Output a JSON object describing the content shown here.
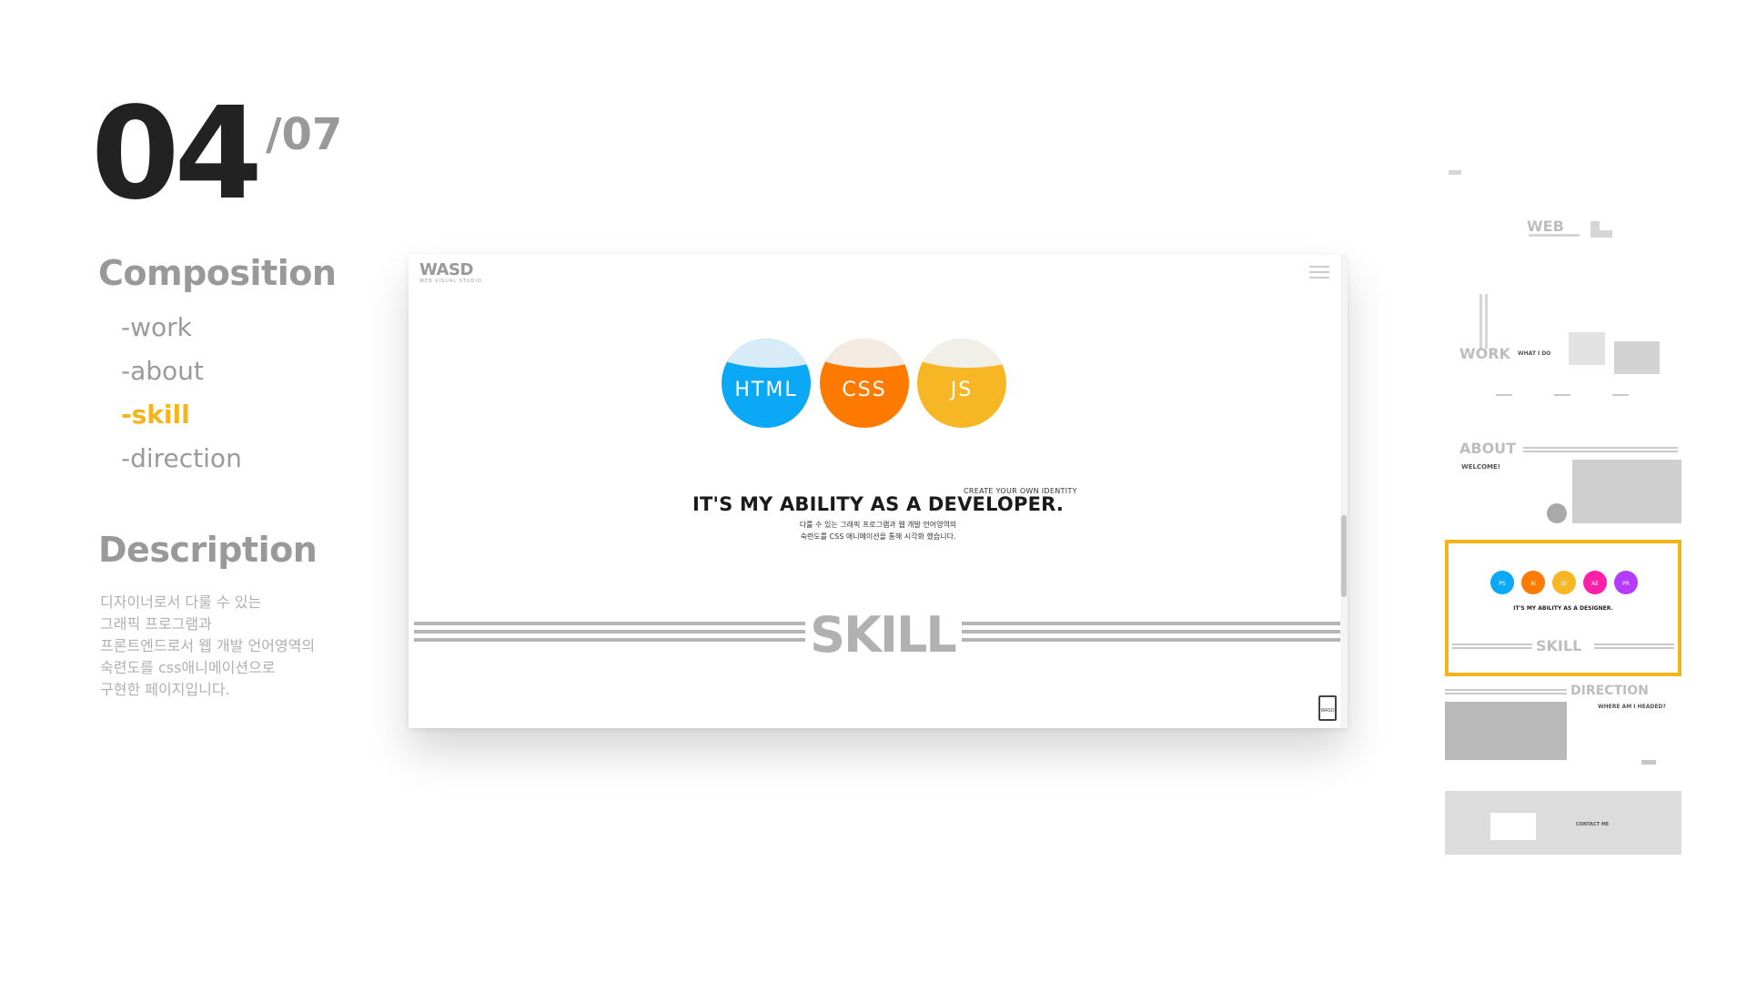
{
  "left_panel": {
    "page_number": "04",
    "page_total": "/07",
    "composition_title": "Composition",
    "nav_items": [
      "-work",
      "-about",
      "-skill",
      "-direction"
    ],
    "active_nav": "-skill",
    "description_title": "Description",
    "description_lines": [
      "디자이너로서 다룰 수 있는",
      "그래픽 프로그램과",
      "프론트엔드로서 웹 개발 언어영역의",
      "숙련도를 css애니메이션으로",
      "구현한 페이지입니다."
    ]
  },
  "browser_mock": {
    "logo": "WASD",
    "logo_sub": "WEB VISUAL STUDIO",
    "skills": [
      {
        "label": "HTML",
        "color": "#0aa8f5",
        "wave_color": "#d7ecf7"
      },
      {
        "label": "CSS",
        "color": "#ff7a00",
        "wave_color": "#f3ebe2"
      },
      {
        "label": "JS",
        "color": "#f7b624",
        "wave_color": "#f1f0e8"
      }
    ],
    "caption": "CREATE YOUR OWN IDENTITY",
    "heading": "IT'S MY ABILITY AS A DEVELOPER.",
    "desc_line1": "다룰 수 있는 그래픽 프로그램과 웹 개발 언어영역의",
    "desc_line2": "숙련도를 CSS 애니메이션을 통해 시각화 했습니다.",
    "section_word": "SKILL",
    "badge_text": "WASD"
  },
  "thumbnails": {
    "t1": {
      "title": "WEB"
    },
    "t2": {
      "title": "WORK",
      "subtitle": "WHAT I DO"
    },
    "t3": {
      "title": "ABOUT",
      "subtitle": "WELCOME!"
    },
    "t4": {
      "heading": "IT'S MY ABILITY AS A DESIGNER.",
      "word": "SKILL",
      "circles": [
        {
          "label": "PS",
          "color": "#0aa8f5"
        },
        {
          "label": "AI",
          "color": "#ff7a00"
        },
        {
          "label": "ID",
          "color": "#f7b624"
        },
        {
          "label": "AE",
          "color": "#ff1fa8"
        },
        {
          "label": "PR",
          "color": "#b43cff"
        }
      ]
    },
    "t5": {
      "title": "DIRECTION",
      "subtitle": "WHERE AM I HEADED?"
    },
    "t6": {
      "label": "CONTACT ME"
    }
  },
  "colors": {
    "accent": "#f4b41a",
    "muted": "#999999",
    "text_dark": "#222222"
  }
}
